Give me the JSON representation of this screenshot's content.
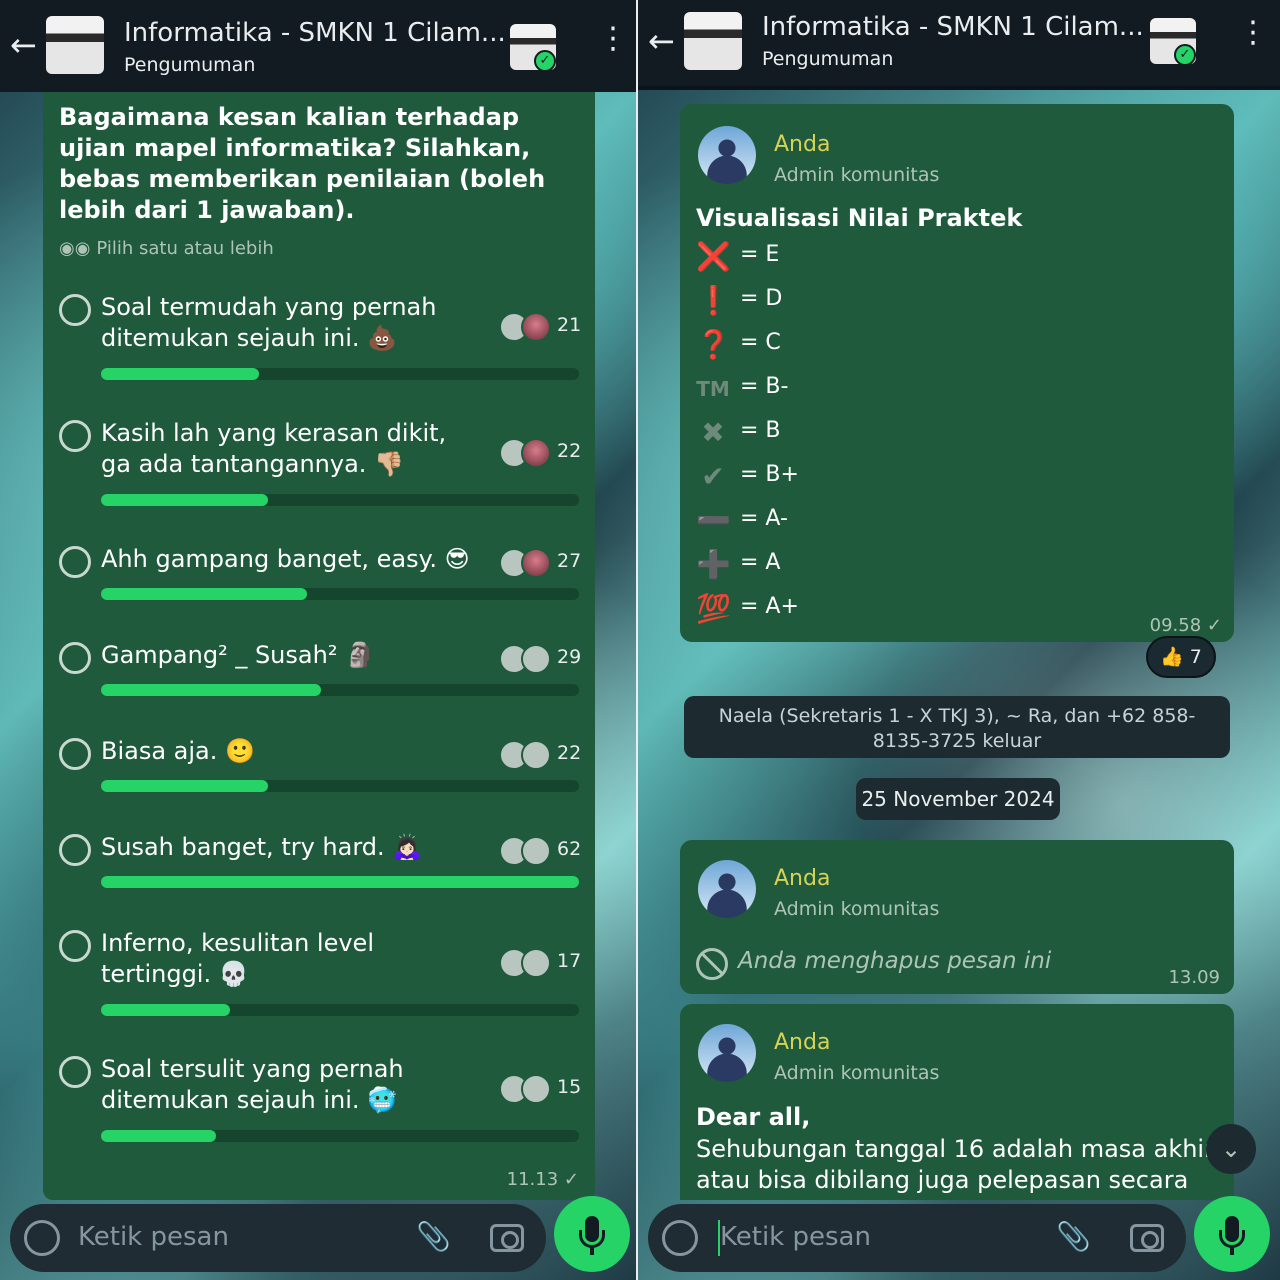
{
  "left": {
    "header": {
      "title": "Informatika - SMKN 1 Cilam...",
      "subtitle": "Pengumuman"
    },
    "poll": {
      "question": "Bagaimana kesan kalian terhadap ujian mapel informatika? Silahkan, bebas memberikan penilaian (boleh lebih dari 1 jawaban).",
      "hint": "Pilih satu atau lebih",
      "options": [
        {
          "text": "Soal termudah yang pernah ditemukan sejauh ini. 💩",
          "votes": "21",
          "share": 0.33
        },
        {
          "text": "Kasih lah yang kerasan dikit, ga ada tantangannya. 👎🏼",
          "votes": "22",
          "share": 0.35
        },
        {
          "text": "Ahh gampang banget, easy. 😎",
          "votes": "27",
          "share": 0.43
        },
        {
          "text": "Gampang² _ Susah² 🗿",
          "votes": "29",
          "share": 0.46
        },
        {
          "text": "Biasa aja. 🙂",
          "votes": "22",
          "share": 0.35
        },
        {
          "text": "Susah banget, try hard. 🙇🏻‍♀️",
          "votes": "62",
          "share": 1.0
        },
        {
          "text": "Inferno, kesulitan level tertinggi. 💀",
          "votes": "17",
          "share": 0.27
        },
        {
          "text": "Soal tersulit yang pernah ditemukan sejauh ini. 🥶",
          "votes": "15",
          "share": 0.24
        }
      ],
      "time": "11.13 ✓"
    },
    "input": {
      "placeholder": "Ketik pesan"
    }
  },
  "right": {
    "header": {
      "title": "Informatika - SMKN 1 Cilam...",
      "subtitle": "Pengumuman"
    },
    "msg1": {
      "sender": "Anda",
      "role": "Admin komunitas",
      "title": "Visualisasi Nilai Praktek",
      "legend": [
        {
          "icon": "❌",
          "label": "= E",
          "color": "#e53935"
        },
        {
          "icon": "❗",
          "label": "= D",
          "color": "#e53935"
        },
        {
          "icon": "❓",
          "label": "= C",
          "color": "#e53935"
        },
        {
          "icon": "TM",
          "label": "= B-",
          "color": "#6e8a7a"
        },
        {
          "icon": "✖",
          "label": "= B",
          "color": "#6e8a7a"
        },
        {
          "icon": "✔",
          "label": "= B+",
          "color": "#6e8a7a"
        },
        {
          "icon": "➖",
          "label": "= A-",
          "color": "#6e8a7a"
        },
        {
          "icon": "➕",
          "label": "= A",
          "color": "#6e8a7a"
        },
        {
          "icon": "💯",
          "label": "= A+",
          "color": "#e53935"
        }
      ],
      "time": "09.58 ✓",
      "reaction": "👍 7"
    },
    "system_note": "Naela (Sekretaris 1 - X TKJ 3), ~ Ra, dan +62 858-8135-3725 keluar",
    "date_chip": "25 November 2024",
    "msg2": {
      "sender": "Anda",
      "role": "Admin komunitas",
      "deleted_text": "Anda menghapus pesan ini",
      "time": "13.09"
    },
    "msg3": {
      "sender": "Anda",
      "role": "Admin komunitas",
      "greeting": "Dear all,",
      "body": "Sehubungan tanggal 16 adalah masa akhir atau bisa dibilang juga pelepasan secara"
    },
    "input": {
      "placeholder": "Ketik pesan"
    }
  }
}
